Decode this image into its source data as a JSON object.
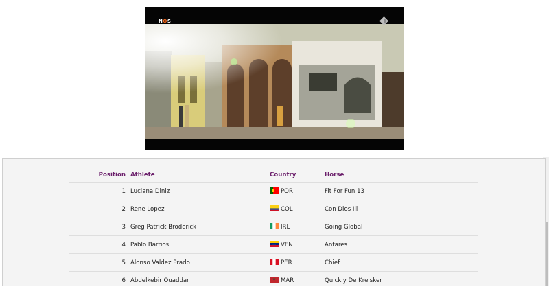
{
  "video": {
    "logo_prefix": "N",
    "logo_mid": "O",
    "logo_suffix": "S"
  },
  "results": {
    "headers": {
      "position": "Position",
      "athlete": "Athlete",
      "country": "Country",
      "horse": "Horse"
    },
    "rows": [
      {
        "position": "1",
        "athlete": "Luciana Diniz",
        "country": "POR",
        "horse": "Fit For Fun 13",
        "flag_icon": "portugal-flag-icon"
      },
      {
        "position": "2",
        "athlete": "Rene Lopez",
        "country": "COL",
        "horse": "Con Dios Iii",
        "flag_icon": "colombia-flag-icon"
      },
      {
        "position": "3",
        "athlete": "Greg Patrick Broderick",
        "country": "IRL",
        "horse": "Going Global",
        "flag_icon": "ireland-flag-icon"
      },
      {
        "position": "4",
        "athlete": "Pablo Barrios",
        "country": "VEN",
        "horse": "Antares",
        "flag_icon": "venezuela-flag-icon"
      },
      {
        "position": "5",
        "athlete": "Alonso Valdez Prado",
        "country": "PER",
        "horse": "Chief",
        "flag_icon": "peru-flag-icon"
      },
      {
        "position": "6",
        "athlete": "Abdelkebir Ouaddar",
        "country": "MAR",
        "horse": "Quickly De Kreisker",
        "flag_icon": "morocco-flag-icon"
      }
    ]
  },
  "colors": {
    "header_text": "#6b1f6b",
    "panel_bg": "#f4f4f4"
  }
}
